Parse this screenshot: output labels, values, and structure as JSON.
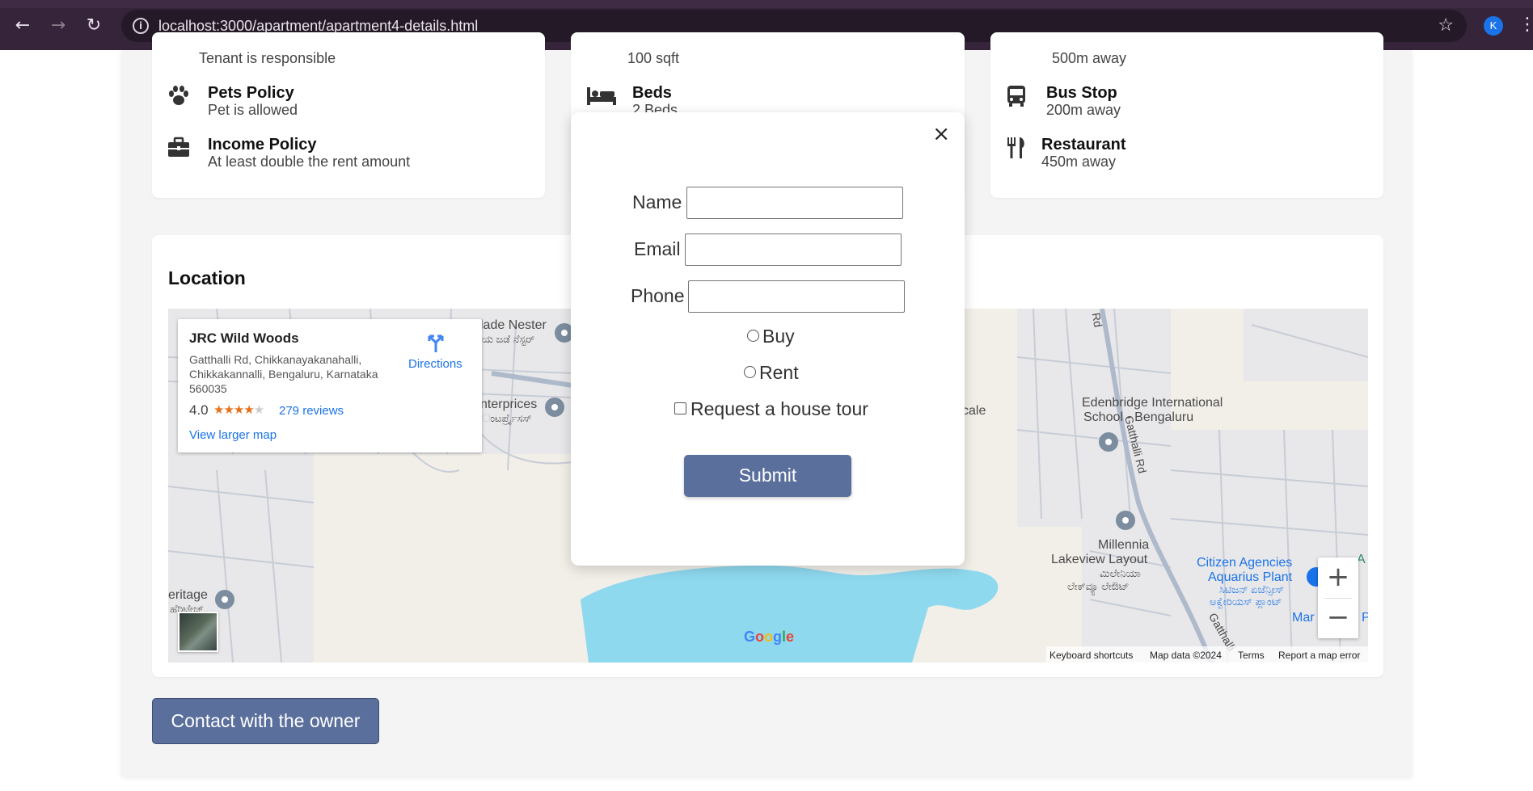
{
  "browser": {
    "url": "localhost:3000/apartment/apartment4-details.html",
    "avatar_letter": "K",
    "back_icon": "←",
    "forward_icon": "→",
    "reload_icon": "↻",
    "info_icon": "i",
    "star_icon": "☆",
    "menu_icon": "⋮"
  },
  "policies": {
    "partial_subtitle": "Tenant is responsible",
    "pets": {
      "title": "Pets Policy",
      "subtitle": "Pet is allowed"
    },
    "income": {
      "title": "Income Policy",
      "subtitle": "At least double the rent amount"
    }
  },
  "details": {
    "size_subtitle": "100 sqft",
    "beds": {
      "title": "Beds",
      "subtitle": "2 Beds"
    }
  },
  "nearby": {
    "partial_subtitle": "500m away",
    "bus": {
      "title": "Bus Stop",
      "subtitle": "200m away"
    },
    "restaurant": {
      "title": "Restaurant",
      "subtitle": "450m away"
    }
  },
  "location": {
    "title": "Location",
    "place": {
      "name": "JRC Wild Woods",
      "address": "Gatthalli Rd, Chikkanayakanahalli, Chikkakannalli, Bengaluru, Karnataka 560035",
      "rating": "4.0",
      "stars_on": "★★★★",
      "stars_off": "★",
      "reviews": "279 reviews",
      "larger_map": "View larger map",
      "directions": "Directions"
    },
    "map_labels": {
      "nest_en": "lade Nester",
      "nest_kn": "ಯ ಜಡೆ ನೆಸ್ಟರ್",
      "ent_en": "nterprices",
      "ent_kn": "ಂಟರ್ಪ್ರೈಸಸ್",
      "cale": "cale",
      "school": "Edenbridge International",
      "school2": "School - Bengaluru",
      "road1": "Rd",
      "road2": "Gatthalli Rd",
      "road3": "Gatthalli",
      "millennia": "Millennia",
      "lakeview": "Lakeview Layout",
      "mill_kn": "ಮಿಲೇನಿಯಾ",
      "lake_kn": "ಲೇಕ್‌ವ್ಯೂ ಲೇಔಟ್",
      "citizen1": "Citizen Agencies",
      "citizen2": "Aquarius Plant",
      "citizen_kn1": "ಸಿಟಿಜನ್ ಏಜೆನ್ಸೀಸ್",
      "citizen_kn2": "ಅಕ್ವೇರಿಯಸ್ ಪ್ಲಾಂಟ್",
      "heritage": "eritage",
      "heritage_kn": "ಹೆರಿಟೇಜ್",
      "edge_a": "A",
      "edge_ma": "Mar",
      "edge_p": "P"
    },
    "zoom_in": "+",
    "zoom_out": "−",
    "google": [
      "G",
      "o",
      "o",
      "g",
      "l",
      "e"
    ],
    "footer": {
      "shortcuts": "Keyboard shortcuts",
      "mapdata": "Map data ©2024",
      "terms": "Terms",
      "report": "Report a map error"
    }
  },
  "contact_button": "Contact with the owner",
  "modal": {
    "close": "×",
    "name_label": "Name",
    "email_label": "Email",
    "phone_label": "Phone",
    "name_value": "",
    "email_value": "",
    "phone_value": "",
    "buy_label": "Buy",
    "rent_label": "Rent",
    "tour_label": "Request a house tour",
    "submit_label": "Submit"
  },
  "colors": {
    "accent": "#5a6f9c",
    "link": "#1a73e8",
    "water": "#8fd9ef",
    "chrome": "#35243a"
  }
}
